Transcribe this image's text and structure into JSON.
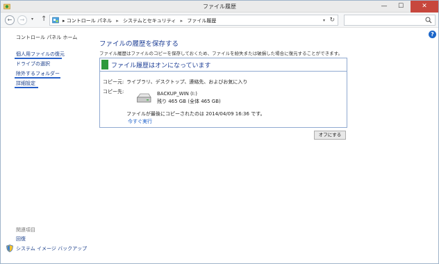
{
  "window": {
    "title": "ファイル履歴",
    "min_glyph": "—",
    "max_glyph": "☐",
    "close_glyph": "✕"
  },
  "navbar": {
    "back_glyph": "←",
    "forward_glyph": "→",
    "dropdown_glyph": "▾",
    "up_glyph": "↑",
    "breadcrumb": [
      "コントロール パネル",
      "システムとセキュリティ",
      "ファイル履歴"
    ],
    "crumb_separator": "▸",
    "refresh_glyph": "↻",
    "search_placeholder": ""
  },
  "sidebar": {
    "home": "コントロール パネル ホーム",
    "links": [
      "個人用ファイルの復元",
      "ドライブの選択",
      "除外するフォルダー",
      "詳細設定"
    ],
    "see_also": "関連項目",
    "see_also_links": [
      "回復",
      "システム イメージ バックアップ"
    ]
  },
  "main": {
    "title": "ファイルの履歴を保存する",
    "description": "ファイル履歴はファイルのコピーを保存しておくため、ファイルを紛失または破損した場合に復元することができます。",
    "status": "ファイル履歴はオンになっています",
    "copy_from_label": "コピー元:",
    "copy_from_value": "ライブラリ、デスクトップ、連絡先、およびお気に入り",
    "copy_to_label": "コピー先:",
    "drive_name": "BACKUP_WIN (I:)",
    "drive_space": "残り 465 GB (全体 465 GB)",
    "last_copy": "ファイルが最後にコピーされたのは 2014/04/09 16:36 です。",
    "run_now": "今すぐ実行",
    "turn_off_button": "オフにする"
  },
  "colors": {
    "status_on": "#2e9a3a",
    "link": "#1a3e8a",
    "annotation_underline": "#2760c9",
    "close_button": "#c7473d"
  },
  "help_glyph": "?"
}
